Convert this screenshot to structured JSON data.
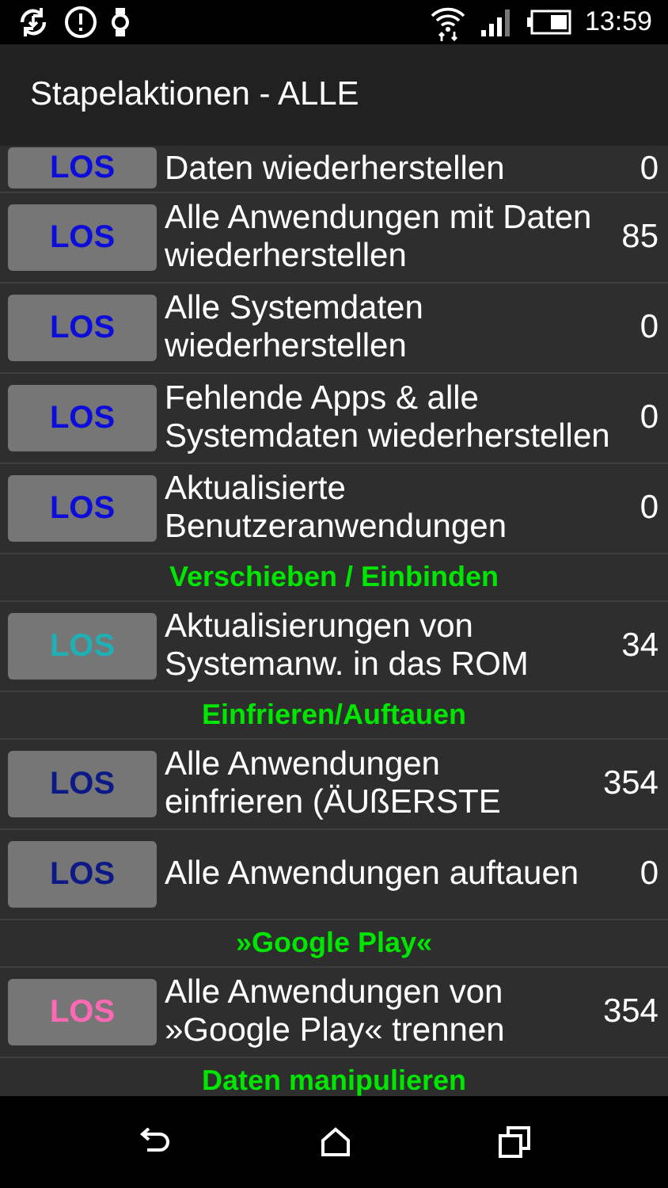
{
  "status_bar": {
    "time": "13:59"
  },
  "app_bar": {
    "title": "Stapelaktionen - ALLE"
  },
  "items": [
    {
      "kind": "action",
      "button": "LOS",
      "color": "#0d0dd9",
      "label": "Daten wiederherstellen",
      "count": "0"
    },
    {
      "kind": "action",
      "button": "LOS",
      "color": "#0d0dd9",
      "label": "Alle Anwendungen mit Daten wiederherstellen",
      "count": "85"
    },
    {
      "kind": "action",
      "button": "LOS",
      "color": "#0d0dd9",
      "label": "Alle Systemdaten wiederherstellen",
      "count": "0"
    },
    {
      "kind": "action",
      "button": "LOS",
      "color": "#0d0dd9",
      "label": "Fehlende Apps & alle Systemdaten wiederherstellen",
      "count": "0"
    },
    {
      "kind": "action",
      "button": "LOS",
      "color": "#0d0dd9",
      "label": "Aktualisierte Benutzeranwendungen",
      "count": "0"
    },
    {
      "kind": "header",
      "label": "Verschieben / Einbinden"
    },
    {
      "kind": "action",
      "button": "LOS",
      "color": "#1fb0b5",
      "label": "Aktualisierungen von Systemanw. in das ROM",
      "count": "34"
    },
    {
      "kind": "header",
      "label": "Einfrieren/Auftauen"
    },
    {
      "kind": "action",
      "button": "LOS",
      "color": "#0d1a85",
      "label": "Alle Anwendungen einfrieren (ÄUßERSTE",
      "count": "354"
    },
    {
      "kind": "action",
      "button": "LOS",
      "color": "#0d1a85",
      "label": "Alle Anwendungen auftauen",
      "count": "0"
    },
    {
      "kind": "header",
      "label": "»Google Play«"
    },
    {
      "kind": "action",
      "button": "LOS",
      "color": "#ff69b4",
      "label": "Alle Anwendungen von »Google Play« trennen",
      "count": "354"
    },
    {
      "kind": "header",
      "label": "Daten manipulieren"
    }
  ]
}
